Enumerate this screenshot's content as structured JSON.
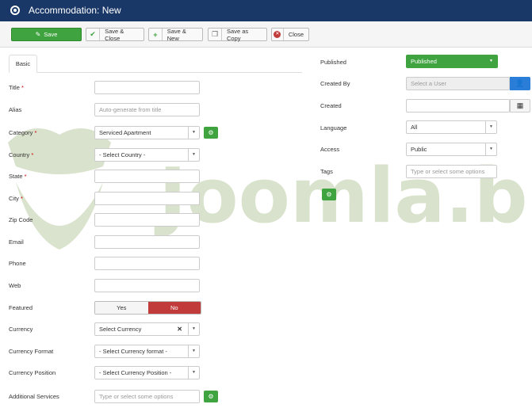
{
  "window": {
    "title": "Accommodation: New"
  },
  "toolbar": {
    "save": "Save",
    "save_close": "Save & Close",
    "save_new": "Save & New",
    "save_copy": "Save as Copy",
    "close": "Close"
  },
  "tabs": [
    {
      "label": "Basic"
    }
  ],
  "form": {
    "title_label": "Title",
    "alias_label": "Alias",
    "alias_placeholder": "Auto-generate from title",
    "category_label": "Category",
    "category_value": "Serviced Apartment",
    "country_label": "Country",
    "country_value": "- Select Country -",
    "state_label": "State",
    "city_label": "City",
    "zip_label": "Zip Code",
    "email_label": "Email",
    "phone_label": "Phone",
    "web_label": "Web",
    "featured_label": "Featured",
    "featured_yes": "Yes",
    "featured_no": "No",
    "currency_label": "Currency",
    "currency_value": "Select Currency",
    "currency_format_label": "Currency Format",
    "currency_format_value": "- Select Currency format -",
    "currency_position_label": "Currency Position",
    "currency_position_value": "- Select Currency Position -",
    "services_label": "Additional Services",
    "services_placeholder": "Type or select some options",
    "required_mark": "*"
  },
  "sidebar": {
    "published_label": "Published",
    "published_value": "Published",
    "created_by_label": "Created By",
    "created_by_placeholder": "Select a User",
    "created_label": "Created",
    "language_label": "Language",
    "language_value": "All",
    "access_label": "Access",
    "access_value": "Public",
    "tags_label": "Tags",
    "tags_placeholder": "Type or select some options"
  },
  "watermark": {
    "text": "Joomla.bio"
  },
  "colors": {
    "header": "#1a3867",
    "green": "#3fa33f",
    "red": "#c23b3b",
    "blue": "#2a7ed8"
  }
}
